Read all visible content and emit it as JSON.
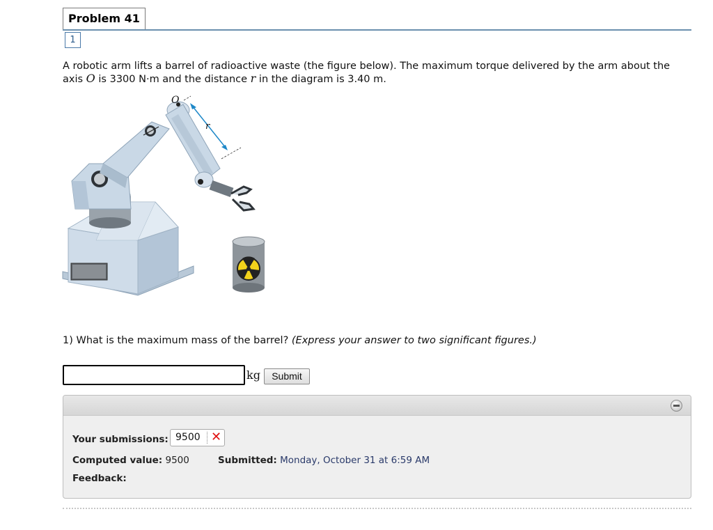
{
  "problem": {
    "title": "Problem 41",
    "part_tab": "1"
  },
  "text": {
    "p1": "A robotic arm lifts a barrel of radioactive waste (the figure below). The maximum torque delivered by the arm about the",
    "p2a": "axis ",
    "axis_var": "O",
    "p2b": " is 3300 N·m and the distance ",
    "dist_var": "r",
    "p2c": " in the diagram is 3.40 m."
  },
  "figure": {
    "label_o": "O",
    "label_r": "r"
  },
  "question": {
    "prefix": "1) What is the maximum mass of the barrel? ",
    "hint": "(Express your answer to two significant figures.)"
  },
  "answer": {
    "value": "",
    "placeholder": "",
    "unit": "kg",
    "submit_label": "Submit"
  },
  "results": {
    "submissions_label": "Your submissions:",
    "submission_value": "9500",
    "submission_status": "✕",
    "computed_label": "Computed value:",
    "computed_value": " 9500",
    "submitted_label": "Submitted:",
    "submitted_value": " Monday, October 31 at 6:59 AM",
    "feedback_label": "Feedback:"
  },
  "colors": {
    "accent_line": "#6a8fae",
    "error": "#e01010",
    "arm": "#c9d8e6",
    "barrel_yellow": "#f2d21b"
  }
}
